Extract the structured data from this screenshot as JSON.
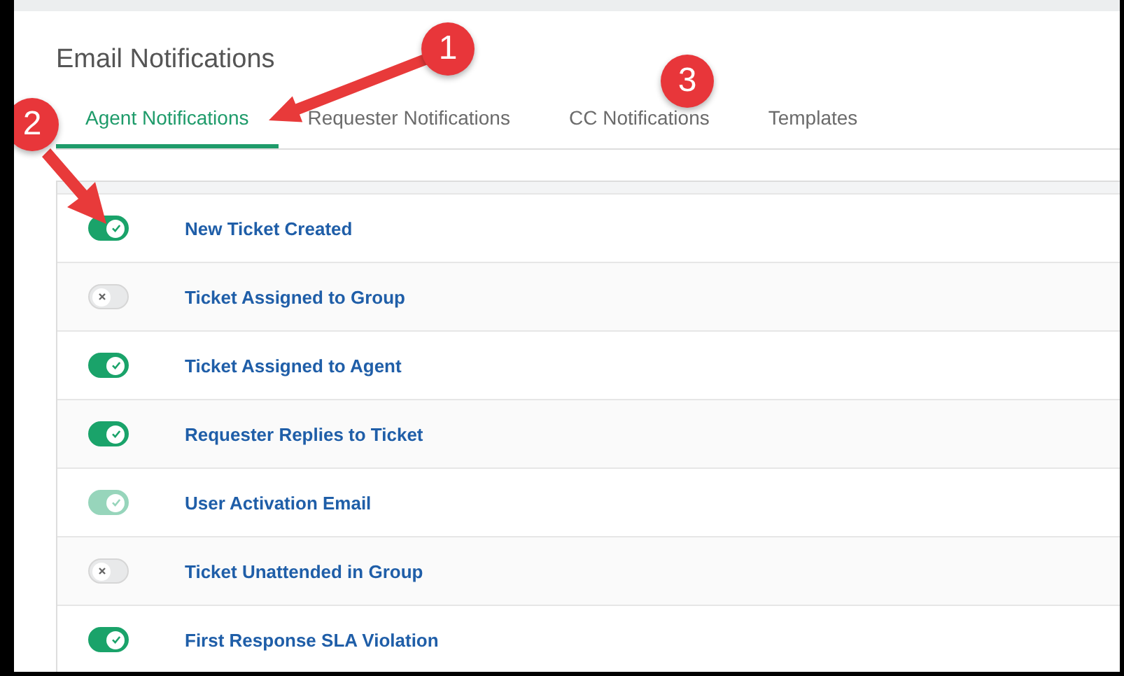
{
  "page": {
    "title": "Email Notifications"
  },
  "tabs": [
    {
      "label": "Agent Notifications",
      "selected": true
    },
    {
      "label": "Requester Notifications",
      "selected": false
    },
    {
      "label": "CC Notifications",
      "selected": false
    },
    {
      "label": "Templates",
      "selected": false
    }
  ],
  "notifications": [
    {
      "label": "New Ticket Created",
      "on": true,
      "disabled": false
    },
    {
      "label": "Ticket Assigned to Group",
      "on": false,
      "disabled": false
    },
    {
      "label": "Ticket Assigned to Agent",
      "on": true,
      "disabled": false
    },
    {
      "label": "Requester Replies to Ticket",
      "on": true,
      "disabled": false
    },
    {
      "label": "User Activation Email",
      "on": true,
      "disabled": true
    },
    {
      "label": "Ticket Unattended in Group",
      "on": false,
      "disabled": false
    },
    {
      "label": "First Response SLA Violation",
      "on": true,
      "disabled": false
    }
  ],
  "callouts": [
    {
      "number": "1",
      "arrow": true
    },
    {
      "number": "2",
      "arrow": true
    },
    {
      "number": "3",
      "arrow": false
    }
  ]
}
